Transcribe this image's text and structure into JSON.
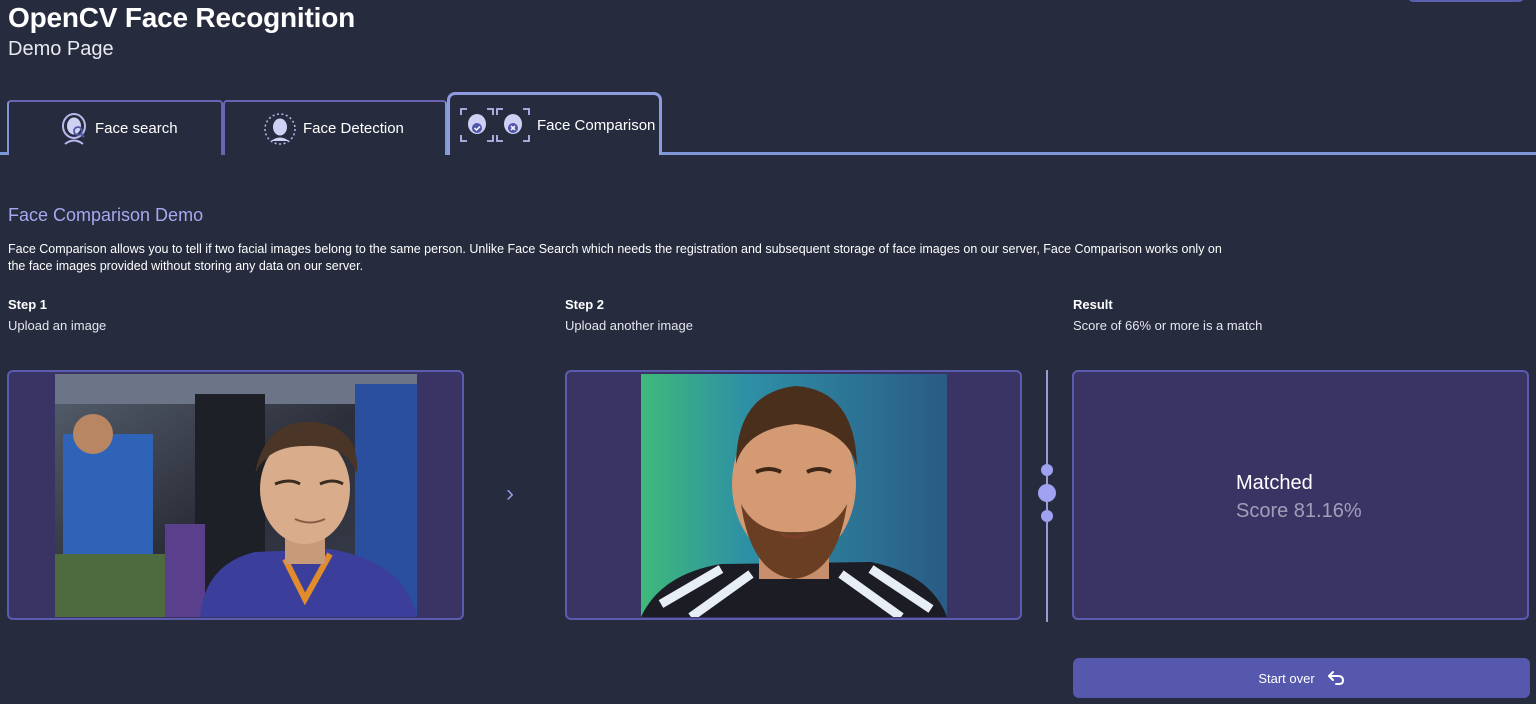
{
  "header": {
    "title": "OpenCV Face Recognition",
    "subtitle": "Demo Page"
  },
  "tabs": [
    {
      "label": "Face search",
      "icon": "face-search-icon"
    },
    {
      "label": "Face Detection",
      "icon": "face-detection-icon"
    },
    {
      "label": "Face Comparison",
      "icon": "face-comparison-icon",
      "active": true
    }
  ],
  "section": {
    "title": "Face Comparison Demo",
    "description": "Face Comparison allows you to tell if two facial images belong to the same person. Unlike Face Search which needs the registration and subsequent storage of face images on our server, Face Comparison works only on the face images provided without storing any data on our server."
  },
  "steps": [
    {
      "heading": "Step 1",
      "subheading": "Upload an image"
    },
    {
      "heading": "Step 2",
      "subheading": "Upload another image"
    },
    {
      "heading": "Result",
      "subheading": "Score of 66% or more is a match"
    }
  ],
  "result": {
    "status": "Matched",
    "score_text": "Score 81.16%"
  },
  "actions": {
    "start_over": "Start over"
  },
  "colors": {
    "background": "#262b3d",
    "panel": "#3a3464",
    "accent": "#5558ad",
    "section_title": "#a8a8f0"
  }
}
